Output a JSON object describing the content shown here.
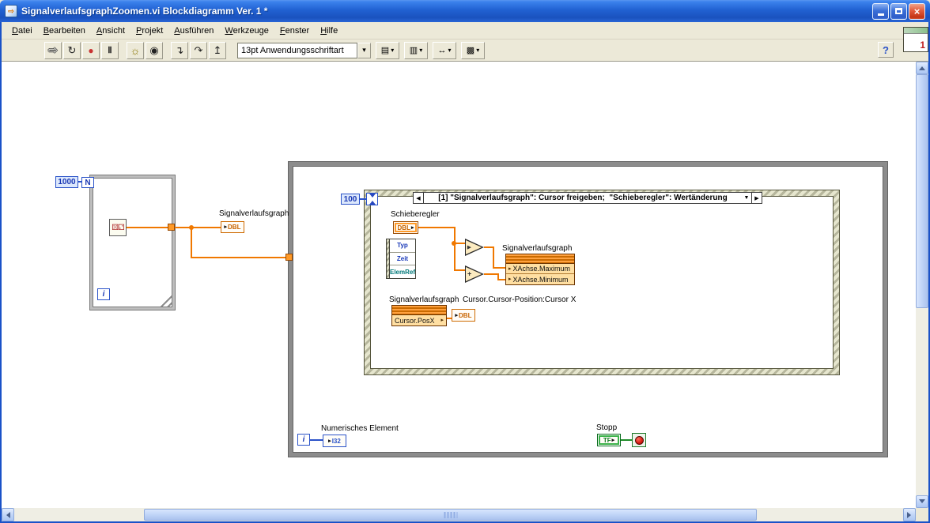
{
  "window": {
    "title": "SignalverlaufsgraphZoomen.vi Blockdiagramm Ver. 1 *"
  },
  "menu": {
    "items": [
      {
        "label": "Datei"
      },
      {
        "label": "Bearbeiten"
      },
      {
        "label": "Ansicht"
      },
      {
        "label": "Projekt"
      },
      {
        "label": "Ausführen"
      },
      {
        "label": "Werkzeuge"
      },
      {
        "label": "Fenster"
      },
      {
        "label": "Hilfe"
      }
    ]
  },
  "toolbar": {
    "run_glyph": "⇨",
    "run_continuous_glyph": "↻",
    "abort_glyph": "●",
    "pause_glyph": "Ⅱ",
    "highlight_glyph": "☼",
    "retain_wires_glyph": "◉",
    "step_into_glyph": "↴",
    "step_over_glyph": "↷",
    "step_out_glyph": "↥",
    "font_selector": "13pt Anwendungsschriftart",
    "dropdown_arrow": "▾",
    "align_glyph": "▤",
    "distribute_glyph": "▥",
    "resize_glyph": "↔",
    "cleanup_glyph": "▩",
    "help_label": "?",
    "vi_icon_number": "1"
  },
  "diagram": {
    "for_loop": {
      "count_value": "1000",
      "count_terminal": "N",
      "iteration_terminal": "i",
      "dice_glyph": "⚄⚁"
    },
    "graph_indicator": {
      "label": "Signalverlaufsgraph",
      "arrow": "▸",
      "type": "DBL"
    },
    "event_structure": {
      "timeout_value": "100",
      "selector": {
        "prev_arrow": "◀",
        "label": "[1] \"Signalverlaufsgraph\": Cursor freigeben;  \"Schieberegler\": Wertänderung",
        "dropdown_arrow": "▼",
        "next_arrow": "▶"
      },
      "slider_control": {
        "label": "Schieberegler",
        "type": "DBL",
        "arrow": "▸"
      },
      "event_data_node": {
        "items": [
          {
            "label": "Typ"
          },
          {
            "label": "Zeit"
          },
          {
            "label": "ElemRef"
          }
        ]
      },
      "compare_node_glyph": "▸",
      "add_node_glyph": "+",
      "axis_property_node": {
        "label": "Signalverlaufsgraph",
        "items": [
          {
            "label": "XAchse.Maximum",
            "arrow": "▸"
          },
          {
            "label": "XAchse.Minimum",
            "arrow": "▸"
          }
        ]
      },
      "cursor_property_node": {
        "label": "Signalverlaufsgraph",
        "items": [
          {
            "label": "Cursor.PosX",
            "arrow": "▸"
          }
        ]
      },
      "cursor_indicator": {
        "label": "Cursor.Cursor-Position:Cursor X",
        "arrow": "▸",
        "type": "DBL"
      }
    },
    "while_loop": {
      "iteration_terminal": "i",
      "numeric_indicator": {
        "label": "Numerisches Element",
        "arrow": "▸",
        "type": "I32"
      },
      "stop_control": {
        "label": "Stopp",
        "type": "TF",
        "arrow": "▸"
      }
    }
  }
}
